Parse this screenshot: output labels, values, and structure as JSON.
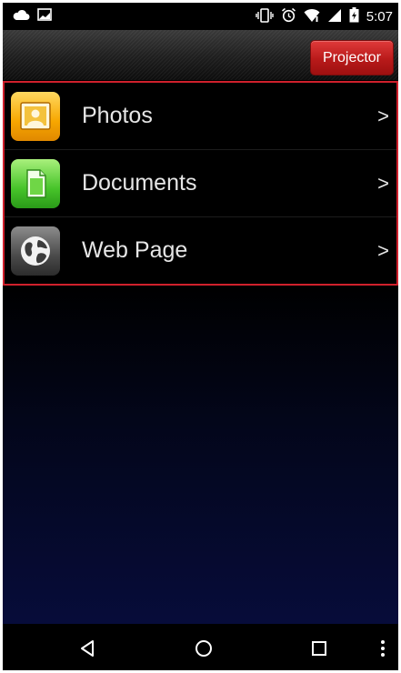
{
  "status_bar": {
    "time": "5:07",
    "left_icons": [
      "cloud-icon",
      "image-icon"
    ],
    "right_icons": [
      "vibrate-icon",
      "alarm-icon",
      "wifi-icon",
      "signal-icon",
      "battery-icon"
    ]
  },
  "action_bar": {
    "projector_label": "Projector"
  },
  "menu": {
    "items": [
      {
        "label": "Photos",
        "icon": "photos-icon",
        "chevron": ">"
      },
      {
        "label": "Documents",
        "icon": "document-icon",
        "chevron": ">"
      },
      {
        "label": "Web Page",
        "icon": "globe-icon",
        "chevron": ">"
      }
    ]
  },
  "nav_bar": {
    "buttons": [
      "back-icon",
      "home-icon",
      "recents-icon",
      "overflow-menu-icon"
    ]
  },
  "colors": {
    "accent_red": "#d0202c",
    "projector_button": "#c21e1e",
    "background": "#000000",
    "content_gradient_end": "#070c3a"
  }
}
